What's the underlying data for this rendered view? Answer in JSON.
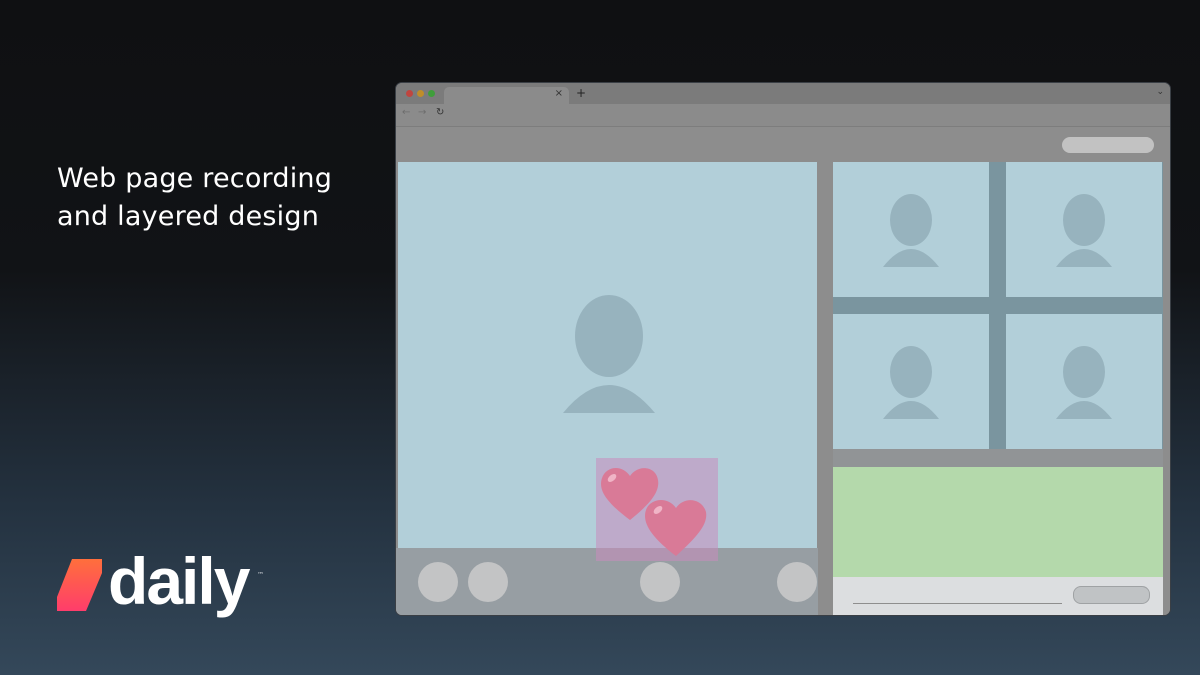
{
  "headline": {
    "line1": "Web page recording",
    "line2": "and layered design"
  },
  "brand": {
    "name": "daily",
    "trademark": "™",
    "gradient_top": "#ff6f3c",
    "gradient_bottom": "#ff3d6b"
  },
  "browser": {
    "tab_close": "×",
    "new_tab": "+",
    "tab_menu": "⌄",
    "nav_back": "←",
    "nav_forward": "→",
    "nav_reload": "↻",
    "traffic_lights": {
      "close": "#c0453f",
      "minimize": "#bf8d2a",
      "maximize": "#3f9e3b"
    }
  },
  "colors": {
    "video_tile": "#b2cfd9",
    "avatar": "#97b3be",
    "chat_panel": "#b4d9ab",
    "overlay": "#c88cbe",
    "heart": "#d97a97"
  },
  "overlay": {
    "icon": "two-hearts-icon"
  },
  "controls": {
    "count": 4
  },
  "grid": {
    "tiles": 4
  }
}
